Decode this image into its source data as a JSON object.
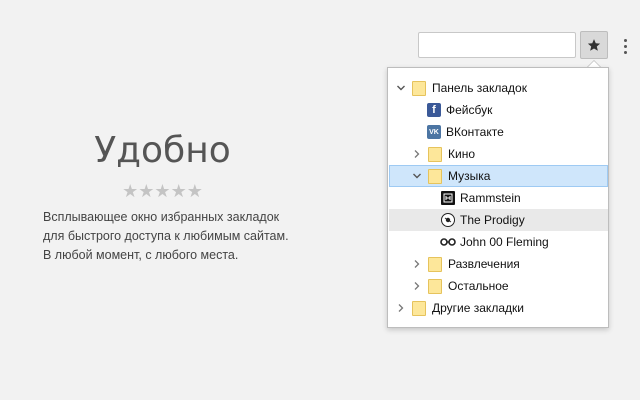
{
  "toolbar": {
    "omnibox_value": "",
    "star_icon": "star-icon",
    "menu_icon": "vertical-dots-icon"
  },
  "promo": {
    "title": "Удобно",
    "stars": "★★★★★",
    "text_lines": [
      "Всплывающее окно избранных закладок",
      "для быстрого доступа к любимым сайтам.",
      "В любой момент, с любого места."
    ]
  },
  "bookmarks": {
    "bar": "Панель закладок",
    "facebook": "Фейсбук",
    "vk": "ВКонтакте",
    "kino": "Кино",
    "music": "Музыка",
    "rammstein": "Rammstein",
    "prodigy": "The Prodigy",
    "fleming": "John 00 Fleming",
    "entertainment": "Развлечения",
    "other": "Остальное",
    "other_bookmarks": "Другие закладки"
  },
  "colors": {
    "folder": "#fde79a",
    "selected_row": "#cfe6fb",
    "facebook": "#3b5998",
    "vk": "#4c75a3"
  }
}
